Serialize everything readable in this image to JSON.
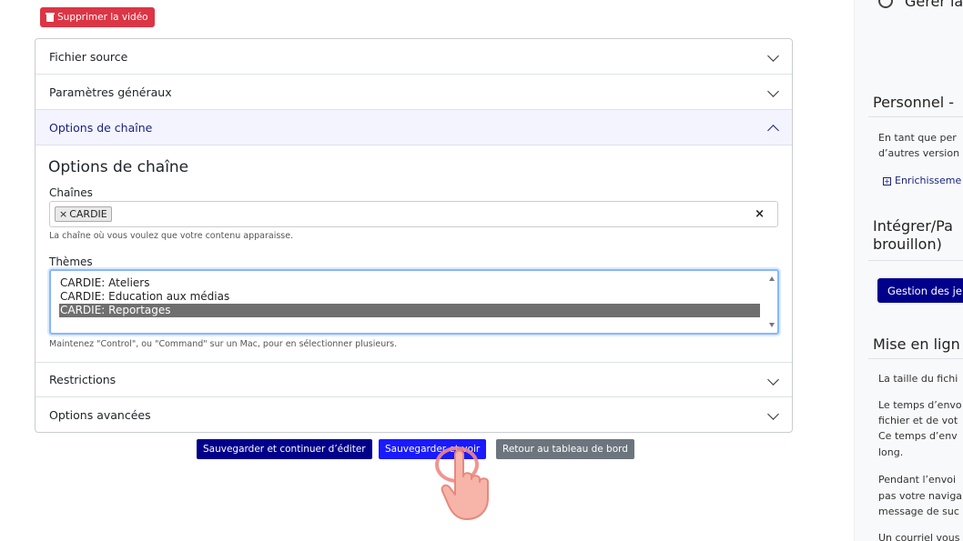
{
  "delete_button": {
    "label": "Supprimer la vidéo"
  },
  "accordion": {
    "items": [
      {
        "label": "Fichier source"
      },
      {
        "label": "Paramètres généraux"
      },
      {
        "label": "Options de chaîne"
      },
      {
        "label": "Restrictions"
      },
      {
        "label": "Options avancées"
      }
    ]
  },
  "channel_options": {
    "title": "Options de chaîne",
    "channels_label": "Chaînes",
    "selected_channel": "CARDIE",
    "channels_help": "La chaîne où vous voulez que votre contenu apparaisse.",
    "themes_label": "Thèmes",
    "themes": [
      "CARDIE: Ateliers",
      "CARDIE: Education aux médias",
      "CARDIE: Reportages"
    ],
    "selected_theme_index": 2,
    "themes_help": "Maintenez \"Control\", ou \"Command\" sur un Mac, pour en sélectionner plusieurs."
  },
  "actions": {
    "save_continue": "Sauvegarder et continuer d’éditer",
    "save_view": "Sauvegarder et voir",
    "back_dashboard": "Retour au tableau de bord"
  },
  "sidebar": {
    "top_heading": "Gérer la",
    "personnel_heading": "Personnel -",
    "personnel_text_1": "En tant que per",
    "personnel_text_2": "d’autres version",
    "enrich_link": "Enrichisseme",
    "integrate_heading_1": "Intégrer/Pa",
    "integrate_heading_2": "brouillon)",
    "sets_button": "Gestion des je",
    "online_heading": "Mise en lign",
    "online_text": [
      "La taille du fichi",
      "Le temps d’envo",
      "fichier et de vot",
      "Ce temps d’env",
      "long.",
      "Pendant l’envoi",
      "pas votre naviga",
      "message de suc",
      "Un courriel vous"
    ]
  },
  "colors": {
    "danger": "#dc3545",
    "primary_dark": "#00008b",
    "primary": "#1a1aff",
    "secondary": "#6c757d",
    "accent_text": "#1a237e"
  }
}
